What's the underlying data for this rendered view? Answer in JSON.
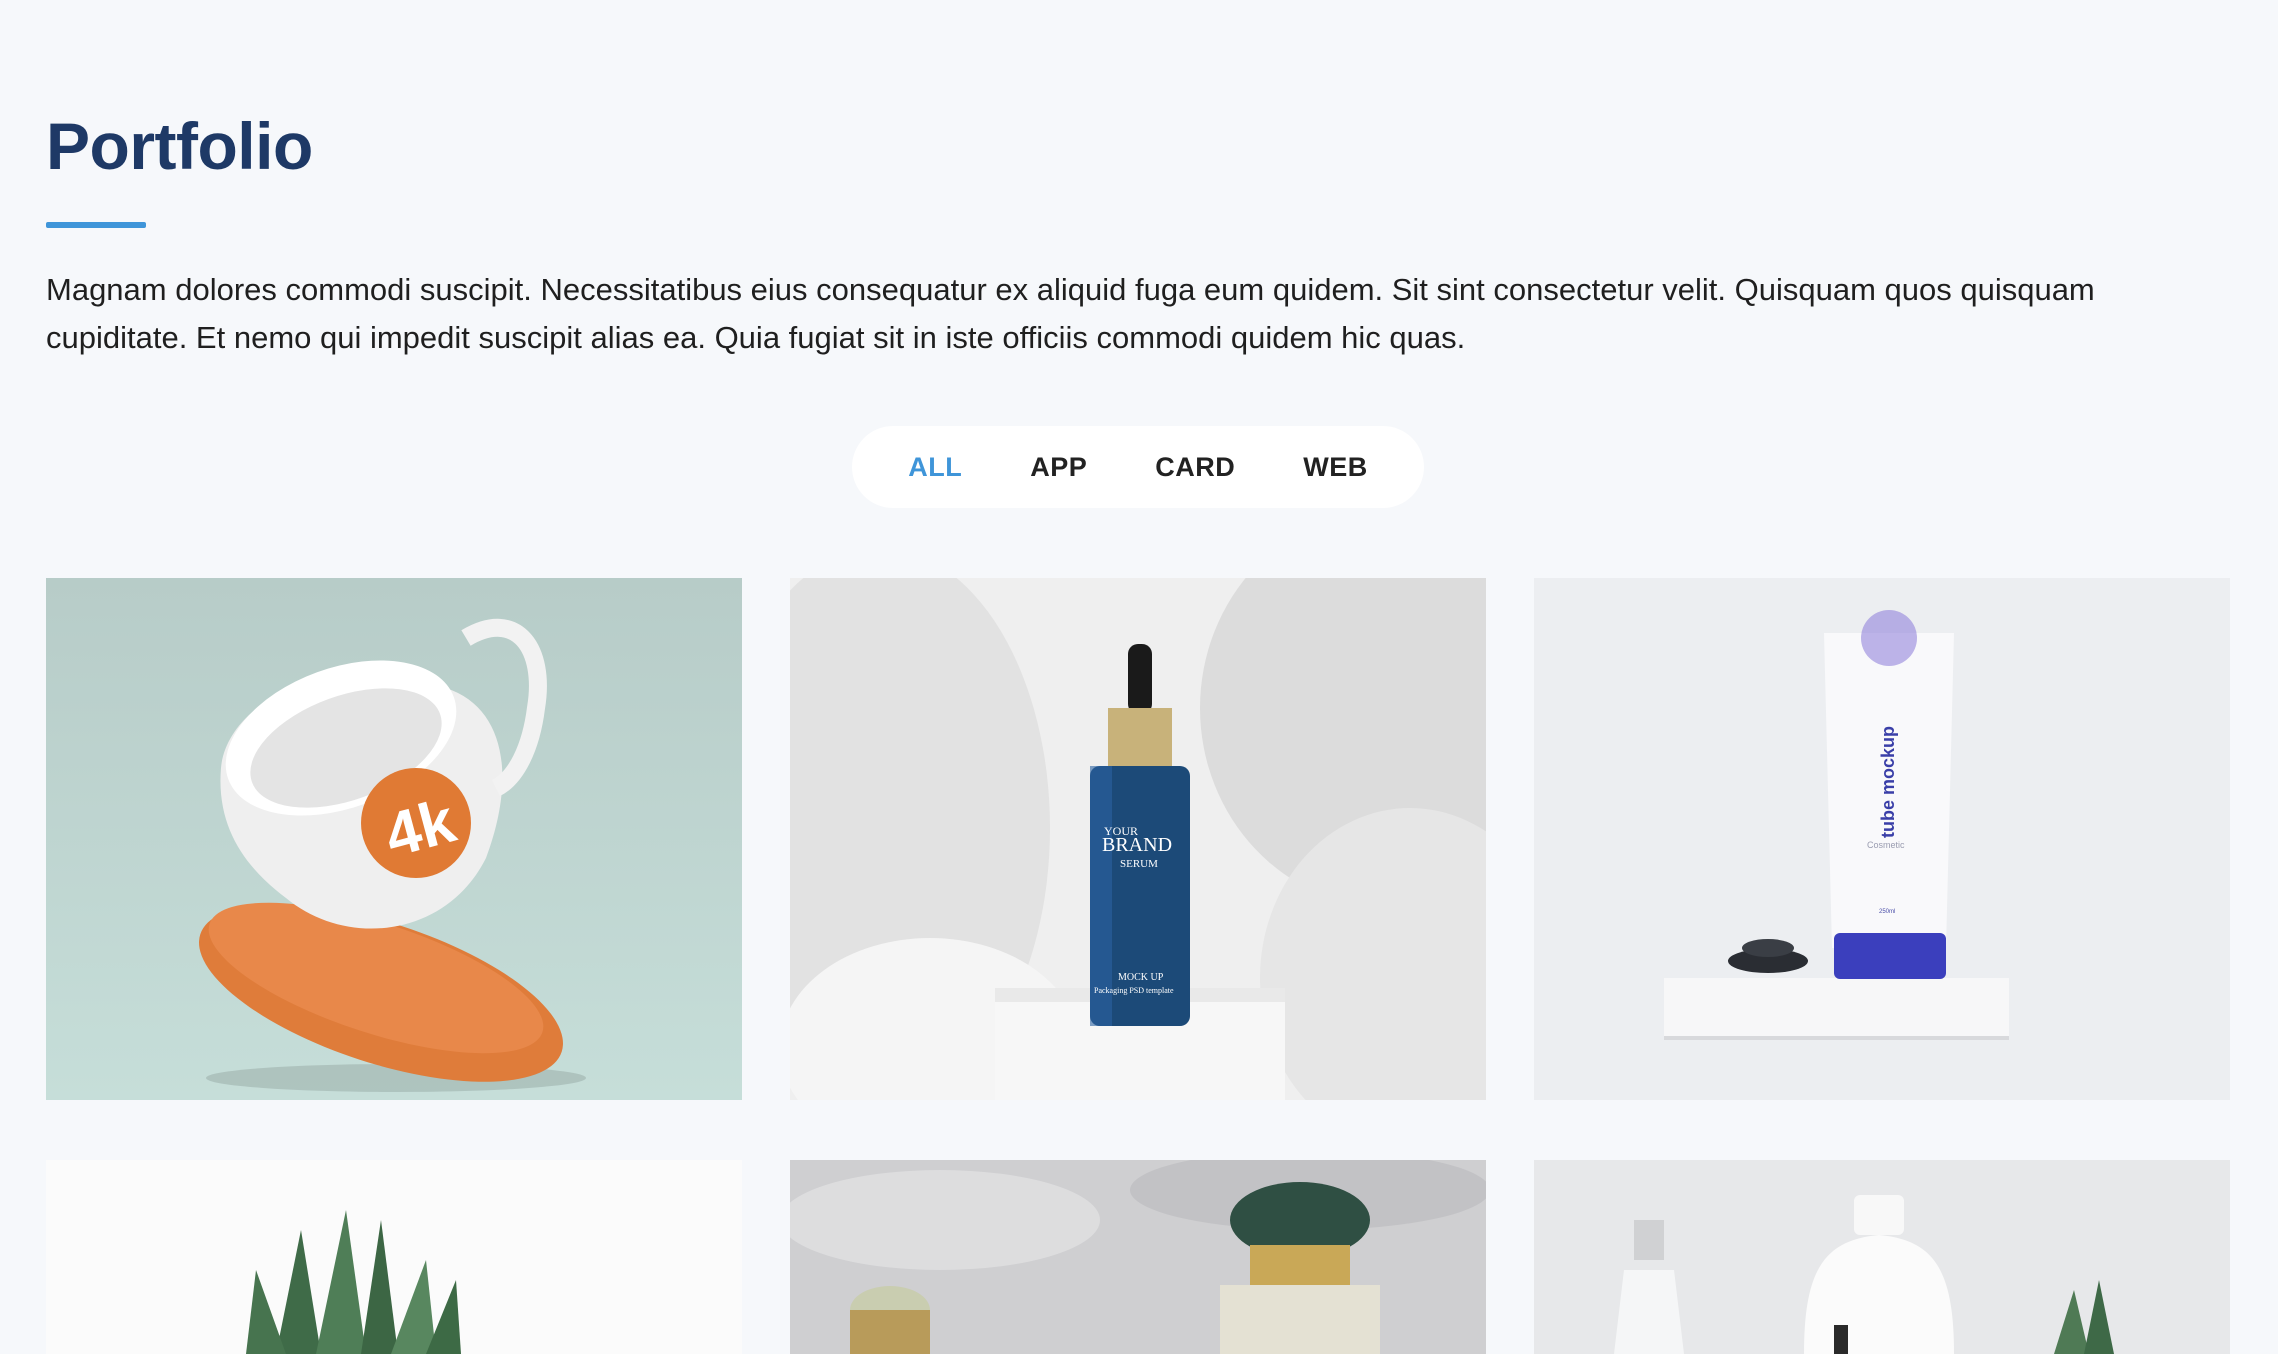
{
  "portfolio": {
    "title": "Portfolio",
    "description": "Magnam dolores commodi suscipit. Necessitatibus eius consequatur ex aliquid fuga eum quidem. Sit sint consectetur velit. Quisquam quos quisquam cupiditate. Et nemo qui impedit suscipit alias ea. Quia fugiat sit in iste officiis commodi quidem hic quas.",
    "filters": [
      {
        "label": "ALL",
        "active": true
      },
      {
        "label": "APP",
        "active": false
      },
      {
        "label": "CARD",
        "active": false
      },
      {
        "label": "WEB",
        "active": false
      }
    ],
    "items": [
      {
        "name": "mug-mockup",
        "text": "4k"
      },
      {
        "name": "serum-bottle-mockup",
        "text_lines": [
          "YOUR",
          "BRAND",
          "SERUM",
          "MOCK UP",
          "Packaging PSD template"
        ]
      },
      {
        "name": "tube-mockup",
        "text_lines": [
          "tube mockup",
          "Cosmetic",
          "250ml"
        ]
      },
      {
        "name": "plant-photo"
      },
      {
        "name": "perfume-photo"
      },
      {
        "name": "bottles-photo"
      }
    ]
  },
  "colors": {
    "page_background": "#f6f8fb",
    "title": "#1e3966",
    "accent": "#3f95d9"
  }
}
